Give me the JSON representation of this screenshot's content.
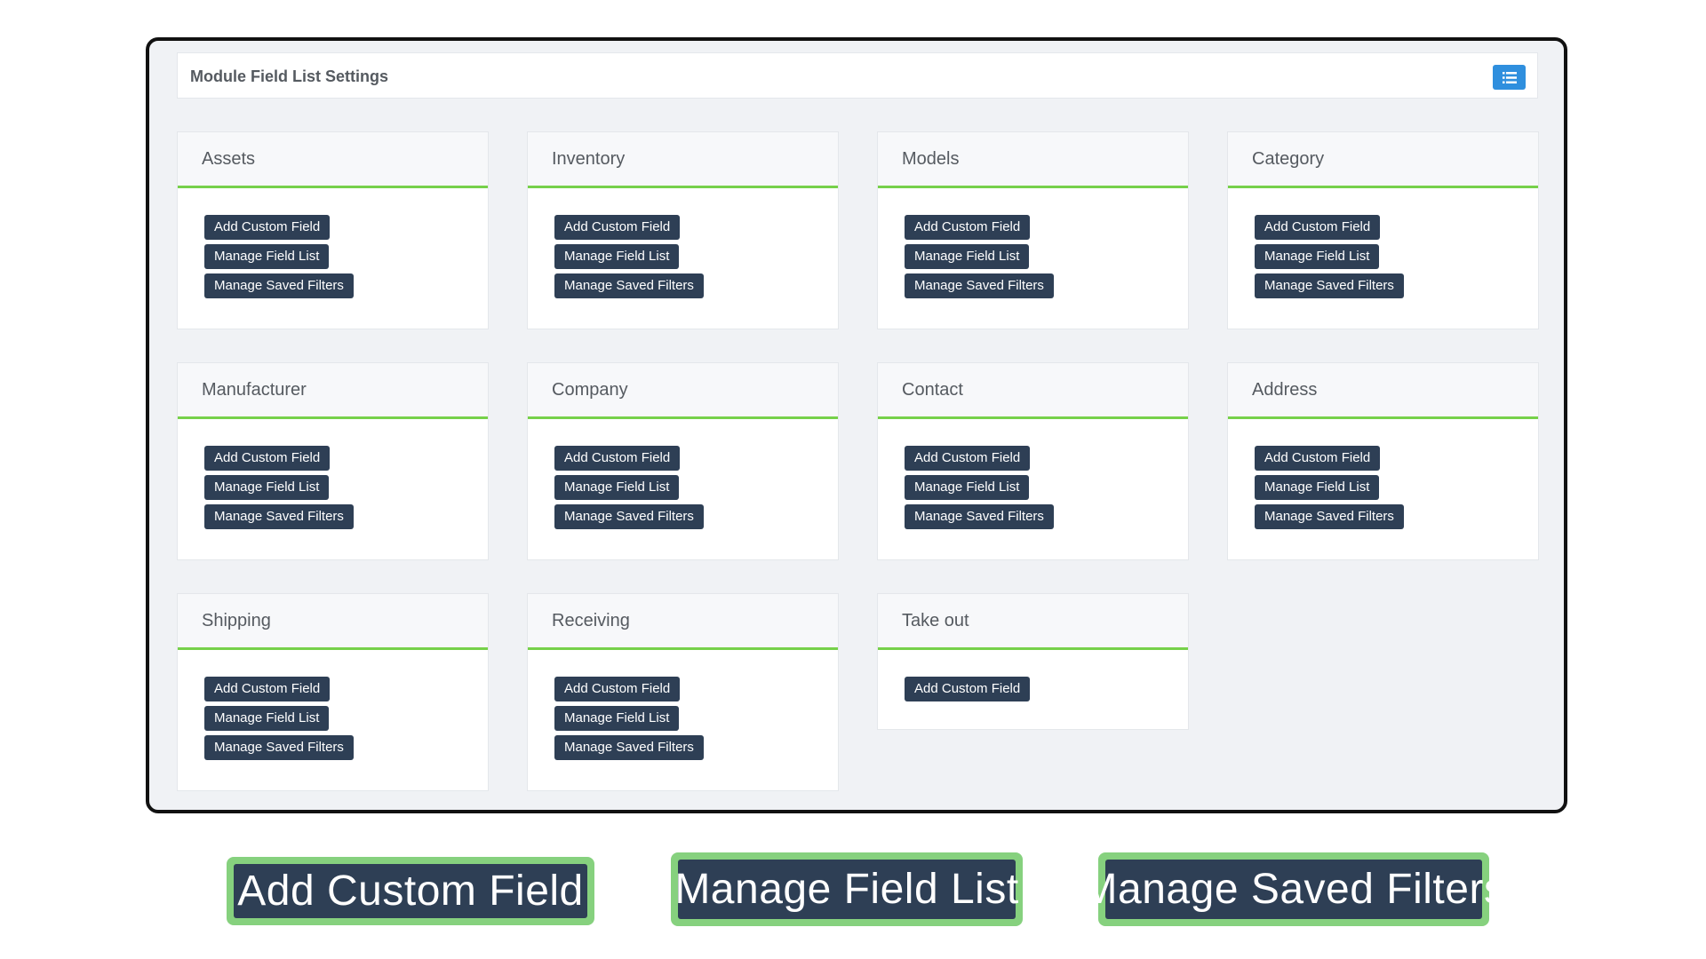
{
  "header": {
    "title": "Module Field List Settings",
    "list_icon": "list-icon",
    "accent_color": "#2f8fde"
  },
  "colors": {
    "button_bg": "#2e3f55",
    "card_underline": "#76d14a",
    "highlight_border": "#86d17e"
  },
  "modules": [
    {
      "title": "Assets",
      "actions": [
        "Add Custom Field",
        "Manage Field List",
        "Manage Saved Filters"
      ]
    },
    {
      "title": "Inventory",
      "actions": [
        "Add Custom Field",
        "Manage Field List",
        "Manage Saved Filters"
      ]
    },
    {
      "title": "Models",
      "actions": [
        "Add Custom Field",
        "Manage Field List",
        "Manage Saved Filters"
      ]
    },
    {
      "title": "Category",
      "actions": [
        "Add Custom Field",
        "Manage Field List",
        "Manage Saved Filters"
      ]
    },
    {
      "title": "Manufacturer",
      "actions": [
        "Add Custom Field",
        "Manage Field List",
        "Manage Saved Filters"
      ]
    },
    {
      "title": "Company",
      "actions": [
        "Add Custom Field",
        "Manage Field List",
        "Manage Saved Filters"
      ]
    },
    {
      "title": "Contact",
      "actions": [
        "Add Custom Field",
        "Manage Field List",
        "Manage Saved Filters"
      ]
    },
    {
      "title": "Address",
      "actions": [
        "Add Custom Field",
        "Manage Field List",
        "Manage Saved Filters"
      ]
    },
    {
      "title": "Shipping",
      "actions": [
        "Add Custom Field",
        "Manage Field List",
        "Manage Saved Filters"
      ]
    },
    {
      "title": "Receiving",
      "actions": [
        "Add Custom Field",
        "Manage Field List",
        "Manage Saved Filters"
      ]
    },
    {
      "title": "Take out",
      "actions": [
        "Add Custom Field"
      ]
    }
  ],
  "highlights": [
    "Add Custom Field",
    "Manage Field List",
    "Manage Saved Filters"
  ]
}
